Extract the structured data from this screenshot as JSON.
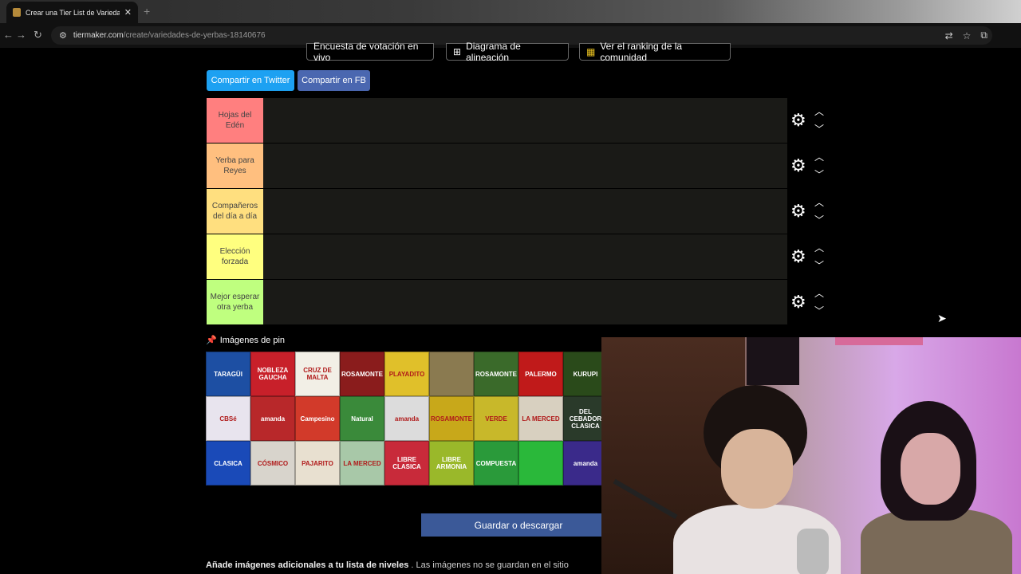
{
  "browser": {
    "tab_title": "Crear una Tier List de Variedade",
    "tab_close": "✕",
    "new_tab": "+",
    "url_host": "tiermaker.com",
    "url_path": "/create/variedades-de-yerbas-18140676"
  },
  "top_buttons": [
    {
      "label": "Encuesta de votación en vivo"
    },
    {
      "label": "Diagrama de alineación"
    },
    {
      "label": "Ver el ranking de la comunidad"
    }
  ],
  "share": {
    "twitter": "Compartir en Twitter",
    "fb": "Compartir en FB"
  },
  "tiers": [
    {
      "label": "Hojas del Edén",
      "color": "#ff7f7f"
    },
    {
      "label": "Yerba para Reyes",
      "color": "#ffbf7f"
    },
    {
      "label": "Compañeros del día a día",
      "color": "#ffdf7f"
    },
    {
      "label": "Elección forzada",
      "color": "#ffff7f"
    },
    {
      "label": "Mejor esperar otra yerba",
      "color": "#bfff7f"
    }
  ],
  "pin_images_title": "Imágenes de pin",
  "yerbas": [
    {
      "name": "TARAGÜI",
      "bg": "#1d4fa3"
    },
    {
      "name": "NOBLEZA GAUCHA",
      "bg": "#c8202a"
    },
    {
      "name": "CRUZ DE MALTA",
      "bg": "#f2efe6"
    },
    {
      "name": "ROSAMONTE",
      "bg": "#8a1c1c"
    },
    {
      "name": "PLAYADITO",
      "bg": "#e0c02a"
    },
    {
      "name": "",
      "bg": "#8a7a50"
    },
    {
      "name": "ROSAMONTE",
      "bg": "#3a6a2a"
    },
    {
      "name": "PALERMO",
      "bg": "#c01a1a"
    },
    {
      "name": "KURUPI",
      "bg": "#2a4a1a"
    },
    {
      "name": "CBSé",
      "bg": "#e8e4ee"
    },
    {
      "name": "amanda",
      "bg": "#b8282a"
    },
    {
      "name": "Campesino",
      "bg": "#d23a2a"
    },
    {
      "name": "Natural",
      "bg": "#3a8a3a"
    },
    {
      "name": "amanda",
      "bg": "#dcdcdc"
    },
    {
      "name": "ROSAMONTE",
      "bg": "#c8a81a"
    },
    {
      "name": "VERDE",
      "bg": "#c8b82a"
    },
    {
      "name": "LA MERCED",
      "bg": "#d8d0c0"
    },
    {
      "name": "DEL CEBADOR CLASICA",
      "bg": "#2a3a2a"
    },
    {
      "name": "CLASICA",
      "bg": "#1a4ab8"
    },
    {
      "name": "CÓSMICO",
      "bg": "#d8d4cc"
    },
    {
      "name": "PAJARITO",
      "bg": "#e8e0d0"
    },
    {
      "name": "LA MERCED",
      "bg": "#a8c8a8"
    },
    {
      "name": "LIBRE CLASICA",
      "bg": "#c82a3a"
    },
    {
      "name": "LIBRE ARMONIA",
      "bg": "#9ab82a"
    },
    {
      "name": "COMPUESTA",
      "bg": "#2a9a3a"
    },
    {
      "name": "",
      "bg": "#2ab83a"
    },
    {
      "name": "amanda",
      "bg": "#3a2a8a"
    }
  ],
  "save_button": "Guardar o descargar",
  "footer": {
    "bold": "Añade imágenes adicionales a tu lista de niveles",
    "rest": " . Las imágenes no se guardan en el sitio"
  }
}
